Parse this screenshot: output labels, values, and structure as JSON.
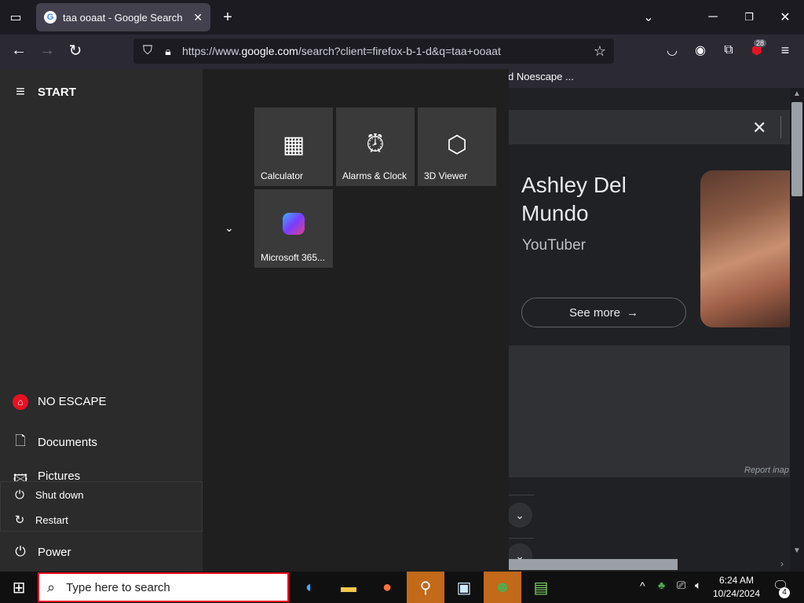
{
  "browser": {
    "tab_title": "taa ooaat - Google Search",
    "url_scheme": "https://www.",
    "url_domain": "google.com",
    "url_path": "/search?client=firefox-b-1-d&q=taa+ooaat",
    "bookmark_item": "d Noescape ...",
    "extension_badge": "28"
  },
  "knowledge_panel": {
    "name": "Ashley Del Mundo",
    "subtitle": "YouTuber",
    "see_more": "See more",
    "report": "Report inap"
  },
  "start_menu": {
    "header": "START",
    "user": "NO ESCAPE",
    "documents": "Documents",
    "pictures": "Pictures",
    "shut_down": "Shut down",
    "restart": "Restart",
    "power": "Power",
    "tiles": [
      {
        "label": "Calculator",
        "icon": "calculator-icon"
      },
      {
        "label": "Alarms & Clock",
        "icon": "alarm-clock-icon"
      },
      {
        "label": "3D Viewer",
        "icon": "cube-icon"
      },
      {
        "label": "Microsoft 365...",
        "icon": "m365-icon"
      }
    ]
  },
  "taskbar": {
    "search_placeholder": "Type here to search",
    "time": "6:24 AM",
    "date": "10/24/2024",
    "notification_count": "4"
  },
  "colors": {
    "accent_orange": "#c2691a",
    "start_bg": "#2b2b2b",
    "tile_bg": "#3a3a3a"
  }
}
